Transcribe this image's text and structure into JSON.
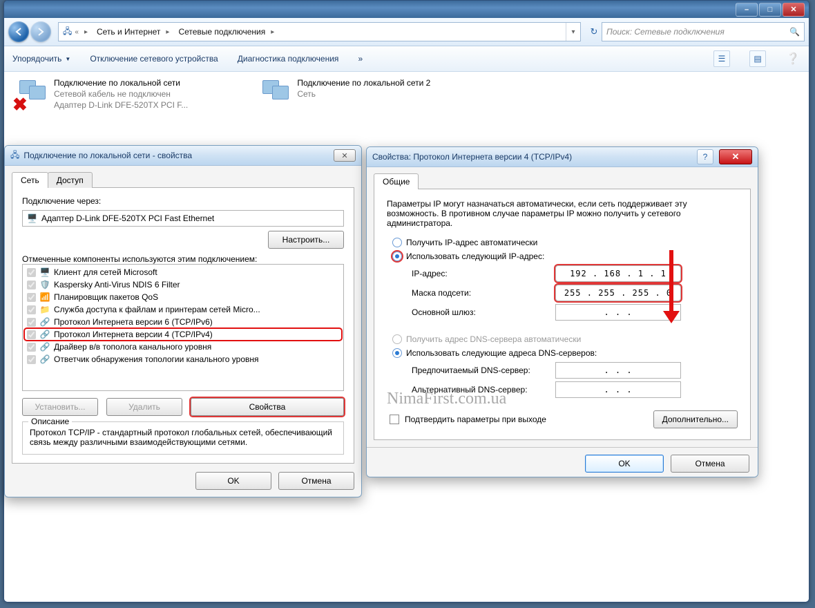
{
  "explorer": {
    "breadcrumb": [
      "Сеть и Интернет",
      "Сетевые подключения"
    ],
    "search_placeholder": "Поиск: Сетевые подключения",
    "toolbar": {
      "organize": "Упорядочить",
      "disable": "Отключение сетевого устройства",
      "diagnose": "Диагностика подключения",
      "more": "»"
    },
    "connections": [
      {
        "title": "Подключение по локальной сети",
        "line2": "Сетевой кабель не подключен",
        "line3": "Адаптер D-Link DFE-520TX PCI F...",
        "disconnected": true
      },
      {
        "title": "Подключение по локальной сети 2",
        "line2": "Сеть",
        "line3": "",
        "disconnected": false
      }
    ]
  },
  "prop_dialog": {
    "title": "Подключение по локальной сети - свойства",
    "tab_network": "Сеть",
    "tab_access": "Доступ",
    "connect_via_label": "Подключение через:",
    "adapter": "Адаптер D-Link DFE-520TX PCI Fast Ethernet",
    "configure_btn": "Настроить...",
    "components_label": "Отмеченные компоненты используются этим подключением:",
    "components": [
      {
        "label": "Клиент для сетей Microsoft",
        "highlight": false
      },
      {
        "label": "Kaspersky Anti-Virus NDIS 6 Filter",
        "highlight": false
      },
      {
        "label": "Планировщик пакетов QoS",
        "highlight": false
      },
      {
        "label": "Служба доступа к файлам и принтерам сетей Micro...",
        "highlight": false
      },
      {
        "label": "Протокол Интернета версии 6 (TCP/IPv6)",
        "highlight": false
      },
      {
        "label": "Протокол Интернета версии 4 (TCP/IPv4)",
        "highlight": true
      },
      {
        "label": "Драйвер в/в тополога канального уровня",
        "highlight": false
      },
      {
        "label": "Ответчик обнаружения топологии канального уровня",
        "highlight": false
      }
    ],
    "install_btn": "Установить...",
    "remove_btn": "Удалить",
    "properties_btn": "Свойства",
    "desc_legend": "Описание",
    "desc_text": "Протокол TCP/IP - стандартный протокол глобальных сетей, обеспечивающий связь между различными взаимодействующими сетями.",
    "ok": "OK",
    "cancel": "Отмена"
  },
  "ipv4_dialog": {
    "title": "Свойства: Протокол Интернета версии 4 (TCP/IPv4)",
    "tab_general": "Общие",
    "intro": "Параметры IP могут назначаться автоматически, если сеть поддерживает эту возможность. В противном случае параметры IP можно получить у сетевого администратора.",
    "radio_auto_ip": "Получить IP-адрес автоматически",
    "radio_static_ip": "Использовать следующий IP-адрес:",
    "ip_label": "IP-адрес:",
    "ip_value": "192 . 168 .  1  .  1",
    "mask_label": "Маска подсети:",
    "mask_value": "255 . 255 . 255 .  0",
    "gw_label": "Основной шлюз:",
    "gw_value": ".       .       .",
    "radio_auto_dns": "Получить адрес DNS-сервера автоматически",
    "radio_static_dns": "Использовать следующие адреса DNS-серверов:",
    "dns1_label": "Предпочитаемый DNS-сервер:",
    "dns1_value": ".       .       .",
    "dns2_label": "Альтернативный DNS-сервер:",
    "dns2_value": ".       .       .",
    "confirm_exit": "Подтвердить параметры при выходе",
    "advanced_btn": "Дополнительно...",
    "ok": "OK",
    "cancel": "Отмена"
  },
  "watermark": "NimaFirst.com.ua"
}
